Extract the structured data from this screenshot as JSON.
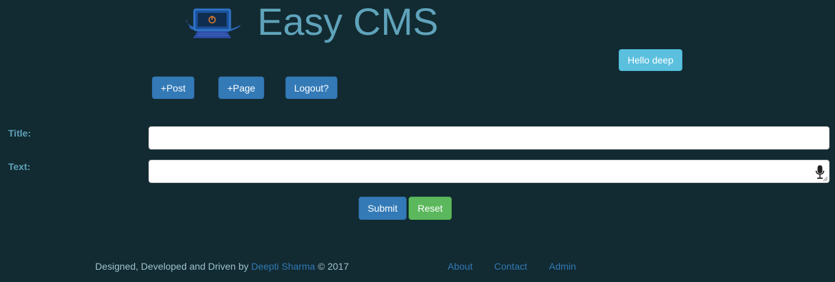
{
  "header": {
    "brand": "Easy CMS",
    "logo_icon": "monitor-power-logo-icon",
    "greeting": "Hello deep"
  },
  "toolbar": {
    "post_label": "+Post",
    "page_label": "+Page",
    "logout_label": "Logout?"
  },
  "form": {
    "title_label": "Title:",
    "title_value": "",
    "text_label": "Text:",
    "text_value": "",
    "mic_icon": "microphone-icon",
    "submit_label": "Submit",
    "reset_label": "Reset"
  },
  "footer": {
    "credit_prefix": "Designed, Developed and Driven by ",
    "author": "Deepti Sharma",
    "credit_suffix": " © 2017",
    "links": [
      "About",
      "Contact",
      "Admin"
    ]
  },
  "colors": {
    "background": "#122a31",
    "brand_text": "#5fa3bb",
    "primary": "#337ab7",
    "info": "#5bc0de",
    "success": "#5cb85c"
  }
}
